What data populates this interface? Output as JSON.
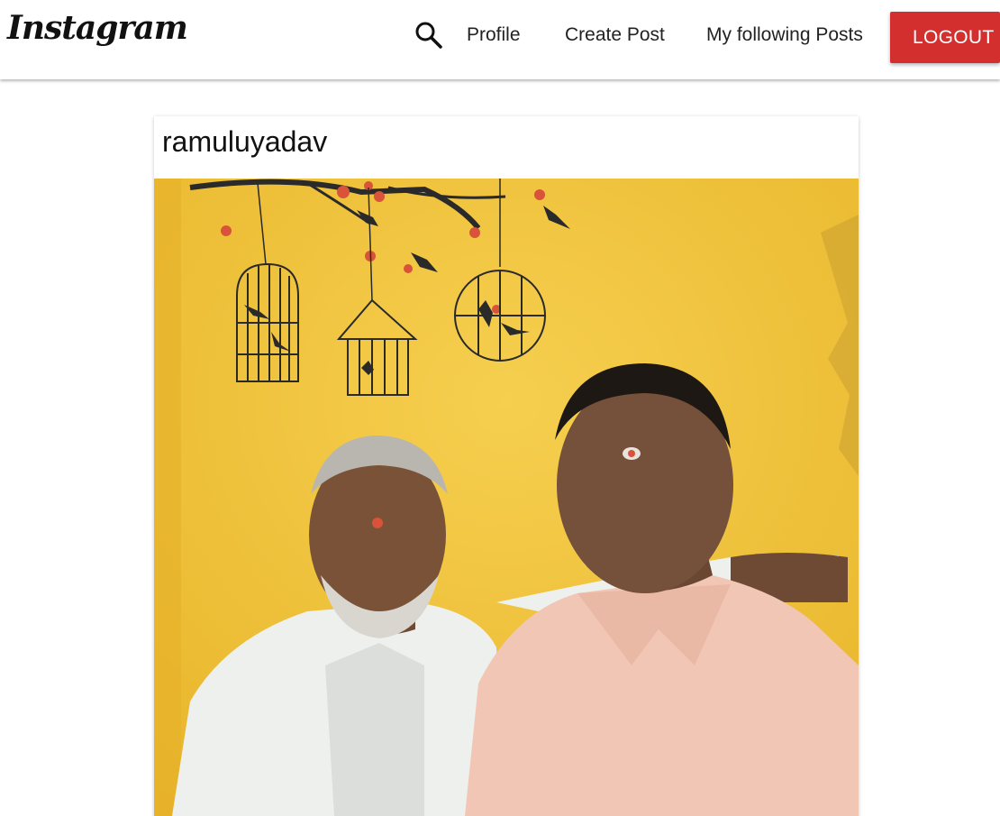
{
  "navbar": {
    "brand": "Instagram",
    "links": {
      "profile": "Profile",
      "create_post": "Create Post",
      "following_posts": "My following Posts"
    },
    "logout_label": "LOGOUT",
    "search_icon": "search-icon"
  },
  "post": {
    "author": "ramuluyadav",
    "image_subject": "photo-of-two-men",
    "colors": {
      "wall": "#f2c233",
      "logout": "#d32f2f"
    }
  }
}
